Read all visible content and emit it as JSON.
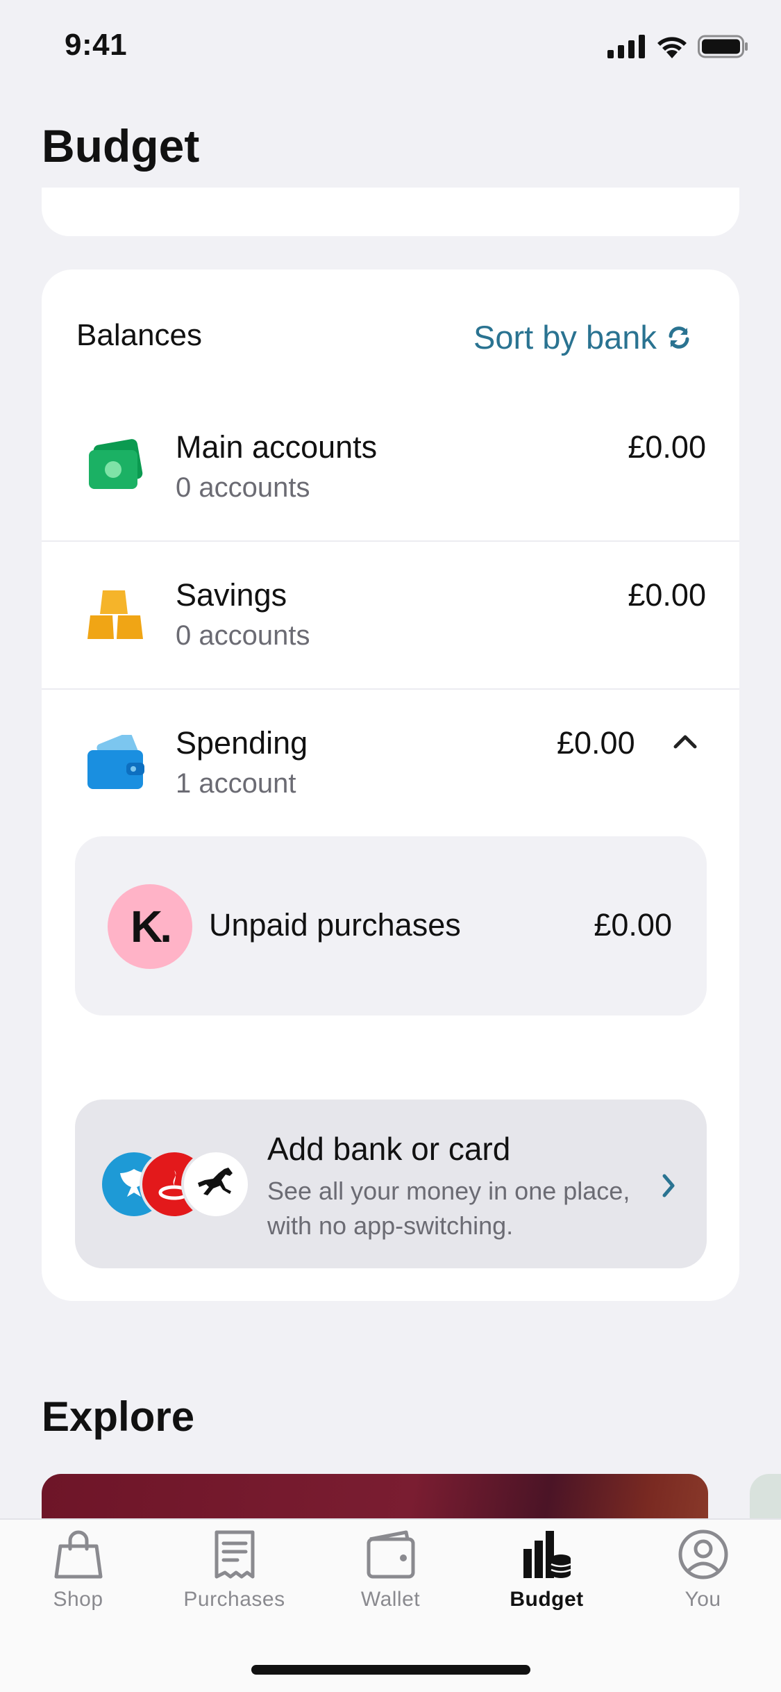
{
  "status_bar": {
    "time": "9:41"
  },
  "header": {
    "title": "Budget"
  },
  "balances": {
    "title": "Balances",
    "sort_label": "Sort by bank",
    "rows": [
      {
        "title": "Main accounts",
        "subtitle": "0 accounts",
        "amount": "£0.00",
        "icon": "cash-icon"
      },
      {
        "title": "Savings",
        "subtitle": "0 accounts",
        "amount": "£0.00",
        "icon": "gold-bars-icon"
      },
      {
        "title": "Spending",
        "subtitle": "1 account",
        "amount": "£0.00",
        "icon": "wallet-card-icon"
      }
    ],
    "unpaid": {
      "label": "Unpaid purchases",
      "amount": "£0.00",
      "logo_letter": "K."
    },
    "add_bank": {
      "title": "Add bank or card",
      "subtitle_line1": "See all your money in one place,",
      "subtitle_line2": "with no app-switching."
    }
  },
  "explore": {
    "title": "Explore"
  },
  "tabs": [
    {
      "label": "Shop",
      "icon": "shopping-bag-icon"
    },
    {
      "label": "Purchases",
      "icon": "receipt-icon"
    },
    {
      "label": "Wallet",
      "icon": "wallet-icon"
    },
    {
      "label": "Budget",
      "icon": "budget-chart-icon",
      "active": true
    },
    {
      "label": "You",
      "icon": "profile-icon"
    }
  ],
  "colors": {
    "accent": "#2a7391",
    "klarna_pink": "#ffb3c7",
    "background": "#f1f1f5"
  }
}
